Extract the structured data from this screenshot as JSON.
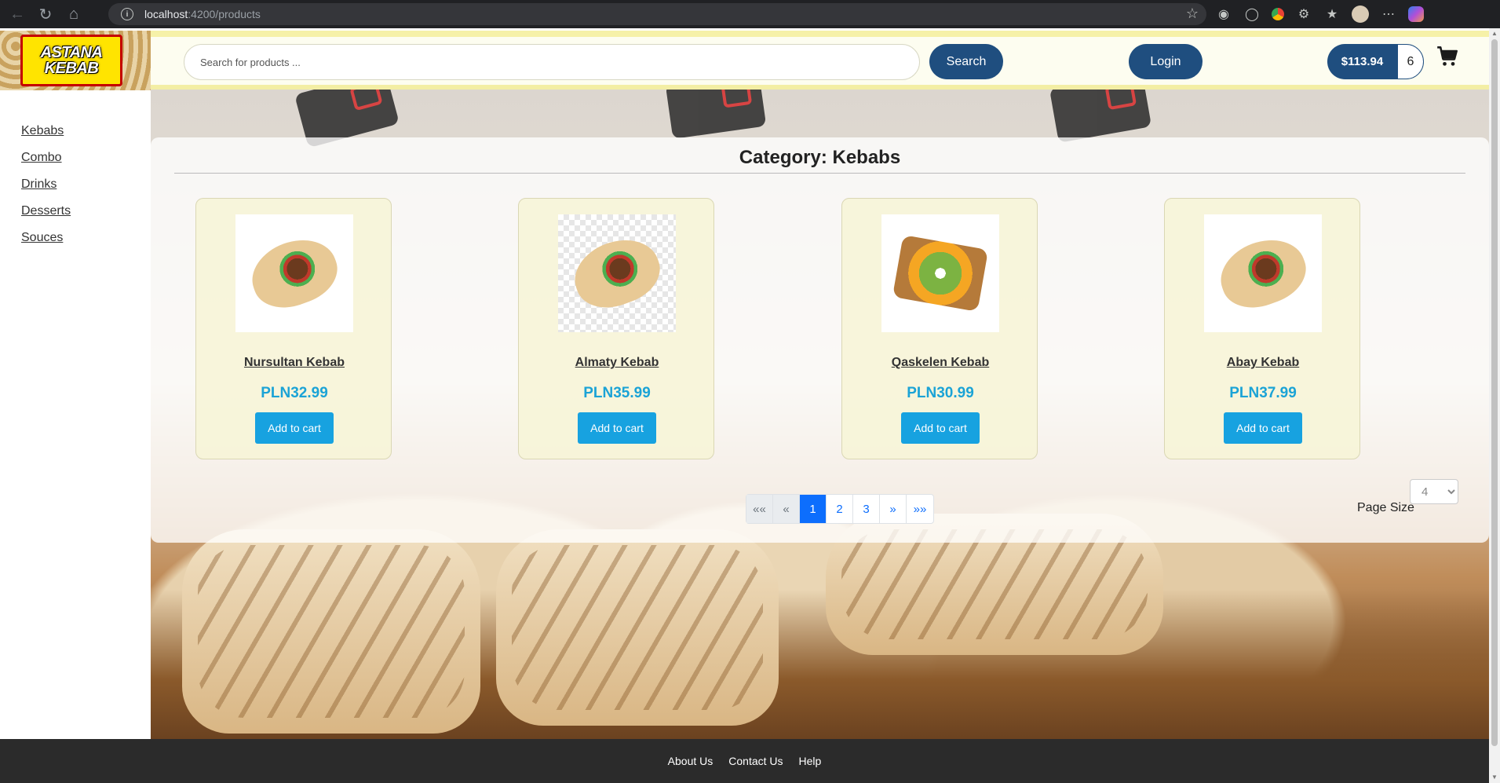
{
  "browser": {
    "url_host": "localhost",
    "url_path": ":4200/products"
  },
  "logo": {
    "line1": "ASTANA",
    "line2": "KEBAB"
  },
  "sidebar": {
    "items": [
      {
        "label": "Kebabs"
      },
      {
        "label": "Combo"
      },
      {
        "label": "Drinks"
      },
      {
        "label": "Desserts"
      },
      {
        "label": "Souces"
      }
    ]
  },
  "header": {
    "search_placeholder": "Search for products ...",
    "search_label": "Search",
    "login_label": "Login",
    "cart_total": "$113.94",
    "cart_count": "6"
  },
  "main": {
    "category_title": "Category: Kebabs",
    "products": [
      {
        "name": "Nursultan Kebab",
        "price": "PLN32.99",
        "button": "Add to cart"
      },
      {
        "name": "Almaty Kebab",
        "price": "PLN35.99",
        "button": "Add to cart"
      },
      {
        "name": "Qaskelen Kebab",
        "price": "PLN30.99",
        "button": "Add to cart"
      },
      {
        "name": "Abay Kebab",
        "price": "PLN37.99",
        "button": "Add to cart"
      }
    ],
    "pagination": {
      "first": "««",
      "prev": "«",
      "pages": [
        "1",
        "2",
        "3"
      ],
      "active_page": "1",
      "next": "»",
      "last": "»»"
    },
    "page_size_label": "Page Size",
    "page_size_value": "4"
  },
  "footer": {
    "links": [
      "About Us",
      "Contact Us",
      "Help"
    ]
  },
  "colors": {
    "header_bg": "#fdfdf0",
    "primary_dark": "#1f4e7f",
    "accent_blue": "#17a2e0",
    "price_blue": "#1ba3d6",
    "footer_bg": "#2b2b2b"
  }
}
